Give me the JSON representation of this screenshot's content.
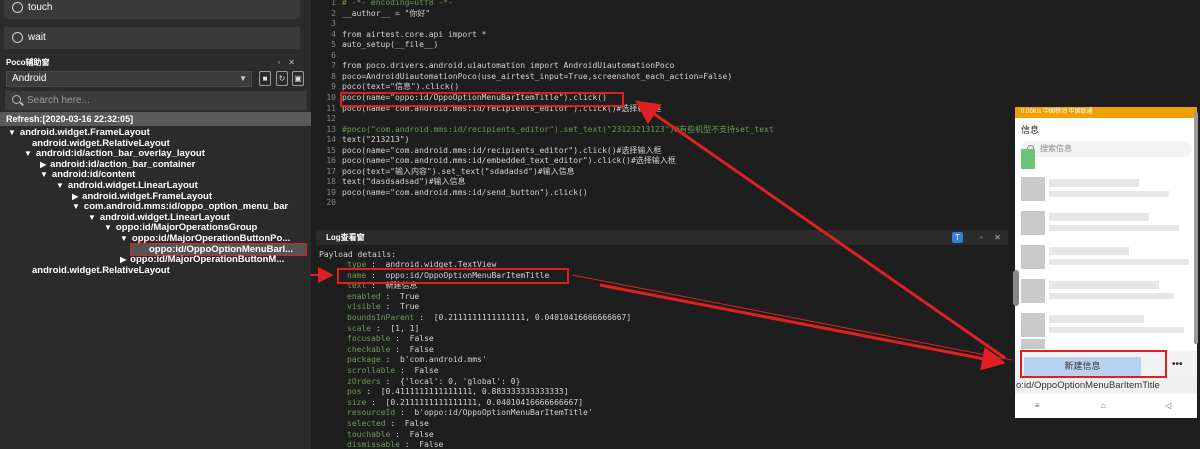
{
  "snippets": [
    {
      "label": "touch",
      "icon": "touch-icon"
    },
    {
      "label": "wait",
      "icon": "clock-icon"
    }
  ],
  "poco_panel": {
    "title": "Poco辅助窗",
    "platform": "Android",
    "search_placeholder": "Search here...",
    "refresh": "Refresh:[2020-03-16 22:32:05]",
    "tree": [
      {
        "label": "android.widget.FrameLayout",
        "expanded": true
      },
      {
        "label": "android.widget.RelativeLayout",
        "expanded": null
      },
      {
        "label": "android:id/action_bar_overlay_layout",
        "expanded": true
      },
      {
        "label": "android:id/action_bar_container",
        "expanded": false
      },
      {
        "label": "android:id/content",
        "expanded": true
      },
      {
        "label": "android.widget.LinearLayout",
        "expanded": true
      },
      {
        "label": "android.widget.FrameLayout",
        "expanded": false
      },
      {
        "label": "com.android.mms:id/oppo_option_menu_bar",
        "expanded": true
      },
      {
        "label": "android.widget.LinearLayout",
        "expanded": true
      },
      {
        "label": "oppo:id/MajorOperationsGroup",
        "expanded": true
      },
      {
        "label": "oppo:id/MajorOperationButtonPo...",
        "expanded": true
      },
      {
        "label": "oppo:id/OppoOptionMenuBarl...",
        "expanded": null,
        "selected": true
      },
      {
        "label": "oppo:id/MajorOperationButtonM...",
        "expanded": false
      },
      {
        "label": "android.widget.RelativeLayout",
        "expanded": null
      }
    ]
  },
  "editor": {
    "lines": [
      {
        "n": "1",
        "text": "# -*- encoding=utf8 -*-",
        "comment": true
      },
      {
        "n": "2",
        "text": "__author__ = \"你好\""
      },
      {
        "n": "3",
        "text": ""
      },
      {
        "n": "4",
        "text": "from airtest.core.api import *"
      },
      {
        "n": "5",
        "text": "auto_setup(__file__)"
      },
      {
        "n": "6",
        "text": ""
      },
      {
        "n": "7",
        "text": "from poco.drivers.android.uiautomation import AndroidUiautomationPoco"
      },
      {
        "n": "8",
        "text": "poco=AndroidUiautomationPoco(use_airtest_input=True,screenshot_each_action=False)"
      },
      {
        "n": "9",
        "text": "poco(text=\"信息\").click()"
      },
      {
        "n": "10",
        "text": "poco(name=\"oppo:id/OppoOptionMenuBarItemTitle\").click()"
      },
      {
        "n": "11",
        "text": "poco(name=\"com.android.mms:id/recipients_editor\").click()#选择输入框"
      },
      {
        "n": "12",
        "text": ""
      },
      {
        "n": "13",
        "text": "#poco(\"com.android.mms:id/recipients_editor\").set_text(\"23123213123\")#有些机型不支持set_text",
        "comment": true
      },
      {
        "n": "14",
        "text": "text(\"213213\")"
      },
      {
        "n": "15",
        "text": "poco(name=\"com.android.mms:id/recipients_editor\").click()#选择输入框"
      },
      {
        "n": "16",
        "text": "poco(name=\"com.android.mms:id/embedded_text_editor\").click()#选择输入框"
      },
      {
        "n": "17",
        "text": "poco(text=\"输入内容\").set_text(\"sdadadsd\")#输入信息"
      },
      {
        "n": "18",
        "text": "text(\"dasdsadsad\")#输入信息"
      },
      {
        "n": "19",
        "text": "poco(name=\"com.android.mms:id/send_button\").click()"
      },
      {
        "n": "20",
        "text": ""
      }
    ]
  },
  "log": {
    "title": "Log查看窗",
    "heading": "Payload details:",
    "rows": [
      {
        "k": "type",
        "v": "android.widget.TextView"
      },
      {
        "k": "name",
        "v": "oppo:id/OppoOptionMenuBarItemTitle"
      },
      {
        "k": "text",
        "v": "新建信息"
      },
      {
        "k": "enabled",
        "v": "True"
      },
      {
        "k": "visible",
        "v": "True"
      },
      {
        "k": "boundsInParent",
        "v": "[0.2111111111111111, 0.04010416666666667]"
      },
      {
        "k": "scale",
        "v": "[1, 1]"
      },
      {
        "k": "focusable",
        "v": "False"
      },
      {
        "k": "checkable",
        "v": "False"
      },
      {
        "k": "package",
        "v": "b'com.android.mms'"
      },
      {
        "k": "scrollable",
        "v": "False"
      },
      {
        "k": "zOrders",
        "v": "{'local': 0, 'global': 0}"
      },
      {
        "k": "pos",
        "v": "[0.4111111111111111, 0.883333333333333]"
      },
      {
        "k": "size",
        "v": "[0.2111111111111111, 0.04010416666666667]"
      },
      {
        "k": "resourceId",
        "v": "b'oppo:id/OppoOptionMenuBarItemTitle'"
      },
      {
        "k": "selected",
        "v": "False"
      },
      {
        "k": "touchable",
        "v": "False"
      },
      {
        "k": "dismissable",
        "v": "False"
      }
    ]
  },
  "phone": {
    "status": "0.00K/s 中国移动 中国联通",
    "title": "信息",
    "search": "搜索信息",
    "new_message": "新建信息",
    "more": "•••",
    "tooltip": "o:id/OppoOptionMenuBarItemTitle",
    "nav": [
      "≡",
      "⌂",
      "◁"
    ]
  },
  "colors": {
    "highlight": "#e02020",
    "comment": "#6a9955",
    "button": "#b9d3ee"
  }
}
